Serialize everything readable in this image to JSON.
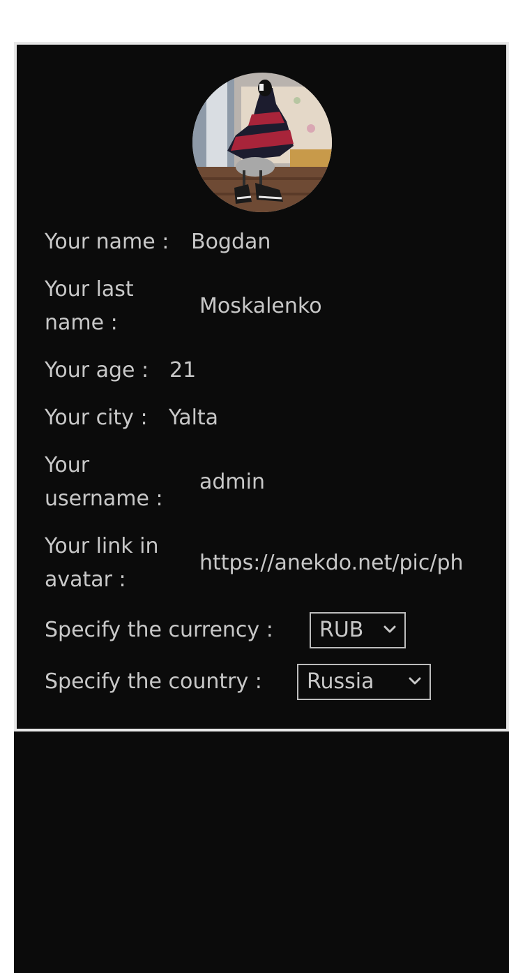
{
  "profile": {
    "avatar_alt": "avatar",
    "fields": {
      "name": {
        "label": "Your name :",
        "value": "Bogdan"
      },
      "last_name": {
        "label": "Your last name :",
        "value": "Moskalenko"
      },
      "age": {
        "label": "Your age :",
        "value": "21"
      },
      "city": {
        "label": "Your city :",
        "value": "Yalta"
      },
      "username": {
        "label": "Your username :",
        "value": "admin"
      },
      "avatar_link": {
        "label": "Your link in avatar :",
        "value": "https://anekdo.net/pic/ph"
      }
    },
    "currency": {
      "label": "Specify the currency :",
      "selected": "RUB"
    },
    "country": {
      "label": "Specify the country :",
      "selected": "Russia"
    }
  },
  "icons": {
    "dropdown": "chevron-down-icon"
  },
  "colors": {
    "card_background": "#0b0b0b",
    "card_border": "#e8e8e8",
    "text": "#c8c8c8",
    "page_background": "#ffffff"
  }
}
